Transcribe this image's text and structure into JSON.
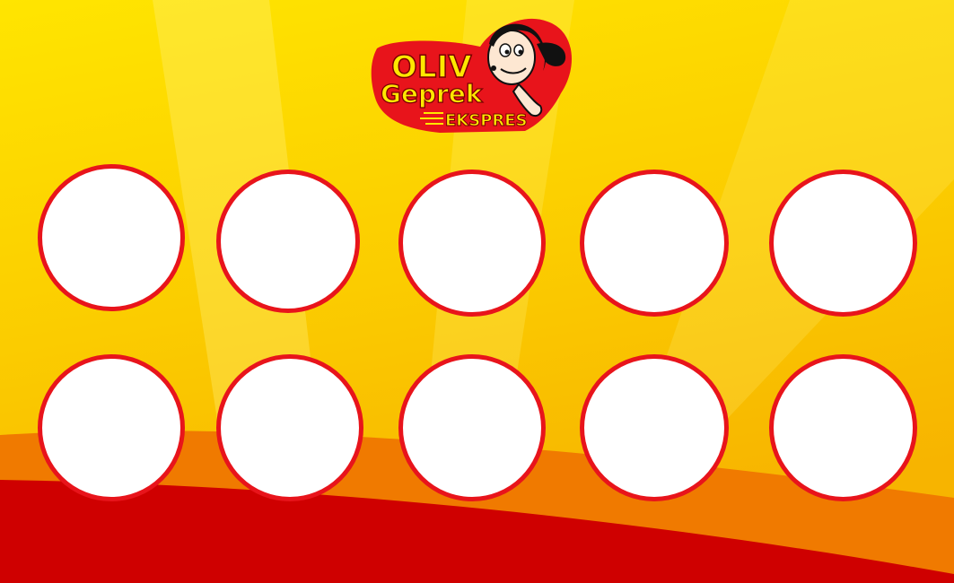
{
  "logo": {
    "line1": "OLIV",
    "line2": "Geprek",
    "line3": "EKSPRES"
  },
  "stamp_card": {
    "rows": 2,
    "columns": 5,
    "slots": [
      "",
      "",
      "",
      "",
      "",
      "",
      "",
      "",
      "",
      ""
    ]
  },
  "colors": {
    "background_yellow": "#f9c300",
    "background_orange": "#f07a00",
    "background_red": "#cf0000",
    "slot_border": "#e8141b",
    "slot_fill": "#ffffff",
    "logo_text_red": "#e8141b",
    "logo_text_yellow": "#ffe800"
  }
}
